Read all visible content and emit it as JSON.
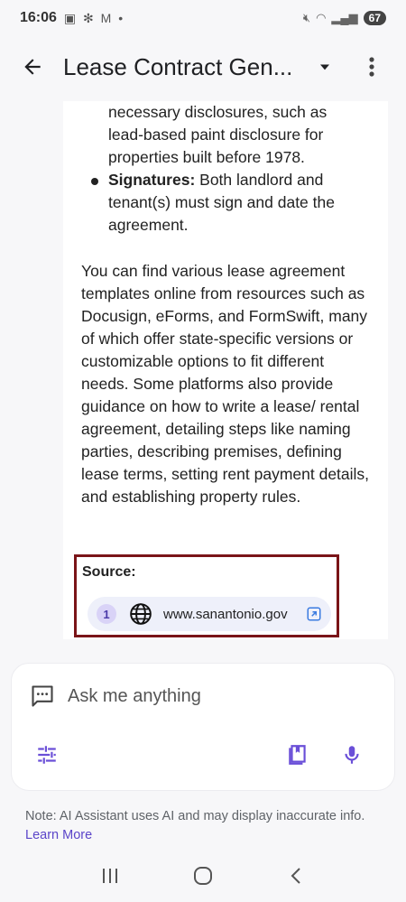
{
  "status_bar": {
    "time": "16:06",
    "left_icons": "▣ ✻ M •",
    "battery": "67"
  },
  "app_bar": {
    "title": "Lease Contract Gen..."
  },
  "content": {
    "continued_lines": [
      "necessary disclosures, such as",
      "lead-based paint disclosure for",
      "properties built before 1978."
    ],
    "bullet": {
      "label": "Signatures:",
      "text": " Both landlord and tenant(s) must sign and date the agreement."
    },
    "paragraph": "You can find various lease agreement templates online from resources such as Docusign, eForms, and FormSwift, many of which offer state-specific versions or customizable options to fit different needs.  Some platforms also provide guidance on how to write a lease/ rental agreement, detailing steps like naming parties, describing premises, defining lease terms, setting rent payment details, and establishing property rules.",
    "source": {
      "label": "Source:",
      "number": "1",
      "site": "www.sanantonio.gov"
    }
  },
  "input": {
    "placeholder": "Ask me anything"
  },
  "note": {
    "text": "Note: AI Assistant uses AI and may display inaccurate info. ",
    "link": "Learn More"
  },
  "colors": {
    "accent": "#6a4fd8",
    "source_border": "#7a1418"
  },
  "icons": {
    "back": "arrow-back-icon",
    "dropdown": "caret-down-icon",
    "more": "more-vert-icon",
    "chat": "chat-bubble-icon",
    "tune": "tune-icon",
    "book": "book-icon",
    "mic": "mic-icon",
    "globe": "globe-icon",
    "link": "open-link-icon"
  }
}
